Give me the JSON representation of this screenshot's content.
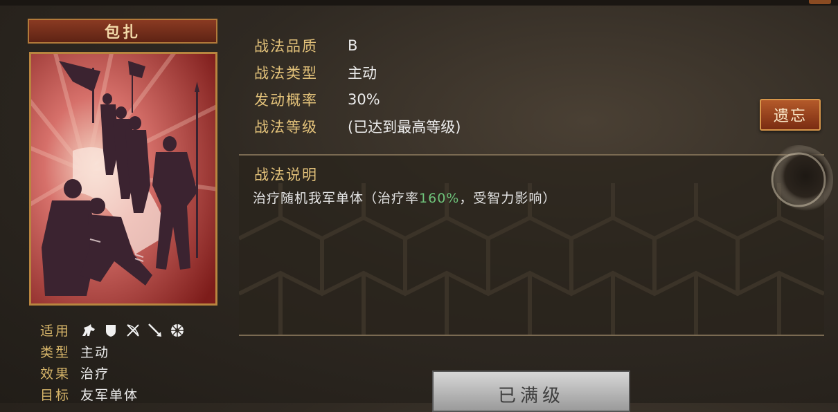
{
  "skill": {
    "name": "包扎"
  },
  "attributes": {
    "applicable_label": "适用",
    "applicable_icons": [
      "cavalry-icon",
      "shield-icon",
      "bow-icon",
      "spear-icon",
      "siege-icon"
    ],
    "type_label": "类型",
    "type_value": "主动",
    "effect_label": "效果",
    "effect_value": "治疗",
    "target_label": "目标",
    "target_value": "友军单体"
  },
  "info": {
    "quality_label": "战法品质",
    "quality_value": "B",
    "category_label": "战法类型",
    "category_value": "主动",
    "chance_label": "发动概率",
    "chance_value": "30%",
    "level_label": "战法等级",
    "level_value": "(已达到最高等级)"
  },
  "description": {
    "title": "战法说明",
    "text_before": "治疗随机我军单体（治疗率",
    "highlight": "160%",
    "text_after": "，受智力影响）"
  },
  "buttons": {
    "forget_label": "遗忘",
    "max_level_label": "已满级"
  },
  "colors": {
    "gold_label": "#e3c27a",
    "highlight_green": "#6ec27a",
    "button_red": "#b45a2a"
  }
}
